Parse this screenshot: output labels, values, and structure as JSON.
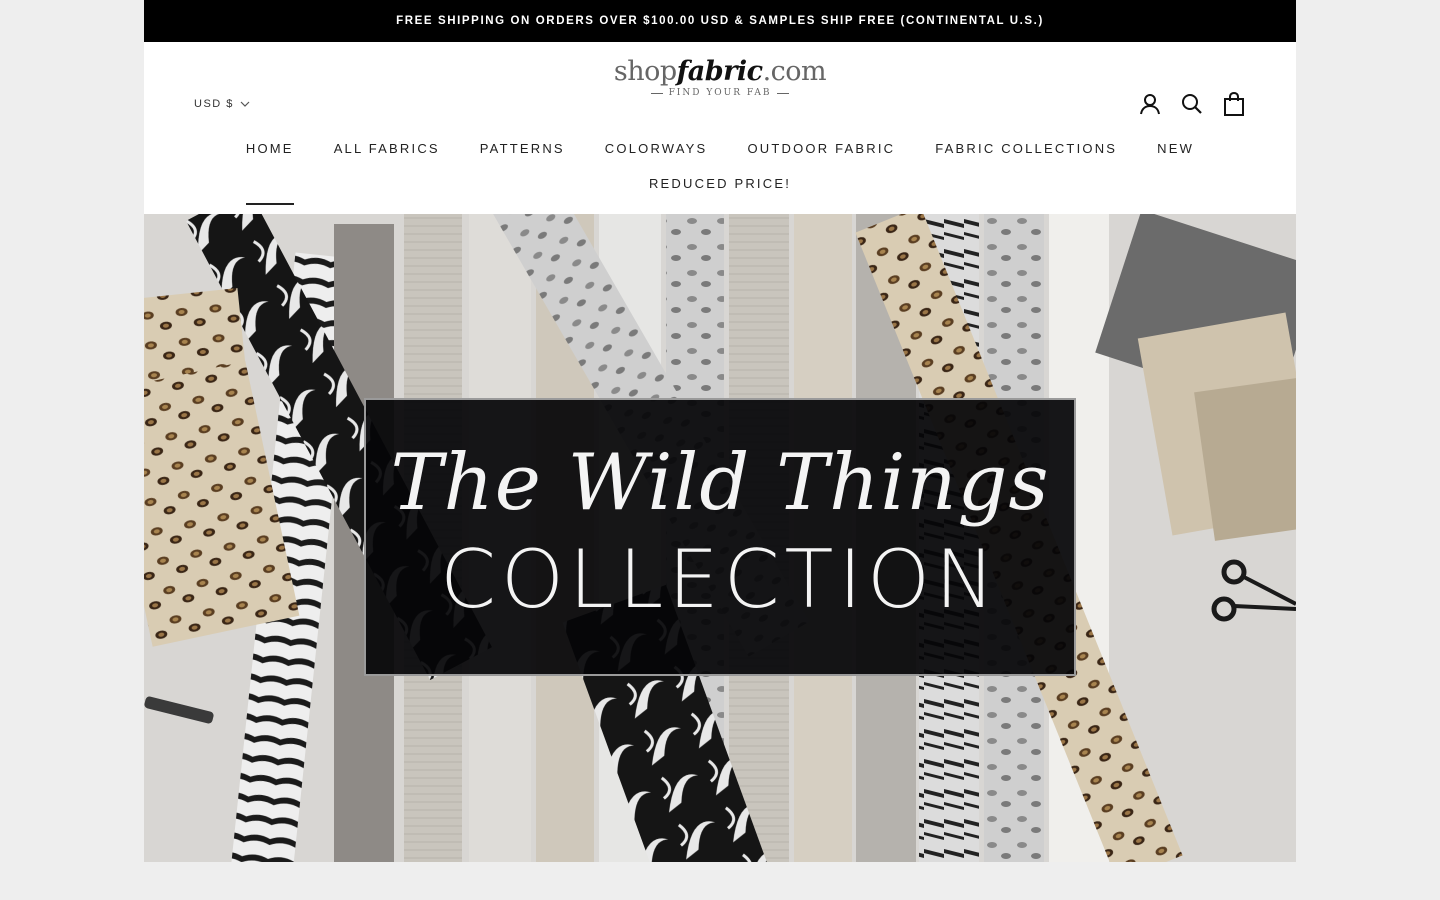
{
  "announcement": {
    "text": "FREE SHIPPING ON ORDERS OVER $100.00 USD & SAMPLES SHIP FREE (CONTINENTAL U.S.)"
  },
  "header": {
    "currency": "USD $",
    "logo": {
      "shop": "shop",
      "fabric": "fabric",
      "com": ".com",
      "tagline": "FIND YOUR FAB"
    },
    "icons": [
      "account-icon",
      "search-icon",
      "cart-icon"
    ]
  },
  "nav": {
    "row1": [
      "HOME",
      "ALL FABRICS",
      "PATTERNS",
      "COLORWAYS",
      "OUTDOOR FABRIC",
      "FABRIC COLLECTIONS",
      "NEW"
    ],
    "row2": [
      "REDUCED PRICE!"
    ],
    "active": "HOME"
  },
  "hero": {
    "script": "The Wild Things",
    "title": "COLLECTION"
  },
  "colors": {
    "announcement_bg": "#000000",
    "page_bg": "#eeeeee",
    "hero_box": "#050508"
  }
}
